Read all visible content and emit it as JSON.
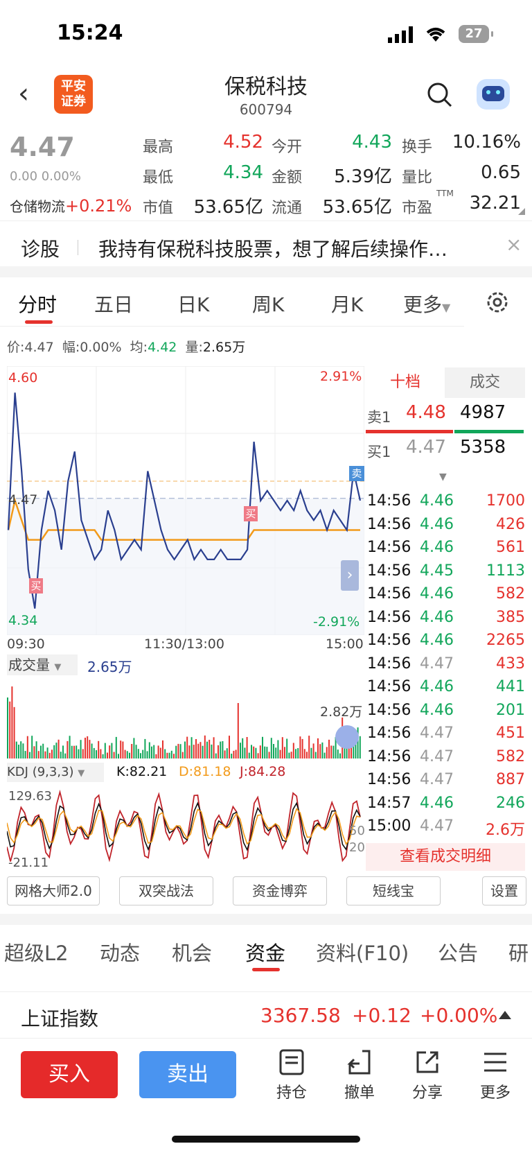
{
  "status": {
    "time": "15:24",
    "battery": "27"
  },
  "header": {
    "name": "保税科技",
    "code": "600794",
    "logo_text": "平安\n证券"
  },
  "quote": {
    "price": "4.47",
    "change": "0.00 0.00%",
    "sector_name": "仓储物流",
    "sector_change": "+0.21%",
    "high_label": "最高",
    "high": "4.52",
    "open_label": "今开",
    "open": "4.43",
    "turnover_label": "换手",
    "turnover": "10.16%",
    "low_label": "最低",
    "low": "4.34",
    "amount_label": "金额",
    "amount": "5.39亿",
    "ratio_label": "量比",
    "ratio": "0.65",
    "mcap_label": "市值",
    "mcap": "53.65亿",
    "float_label": "流通",
    "float": "53.65亿",
    "pe_label": "市盈",
    "pe_sup": "TTM",
    "pe": "32.21"
  },
  "diagnose": {
    "label": "诊股",
    "text": "我持有保税科技股票，想了解后续操作…"
  },
  "chart_tabs": [
    "分时",
    "五日",
    "日K",
    "周K",
    "月K",
    "更多"
  ],
  "info_line": {
    "price_label": "价:",
    "price": "4.47",
    "amp_label": "幅:",
    "amp": "0.00%",
    "avg_label": "均:",
    "avg": "4.42",
    "vol_label": "量:",
    "vol": "2.65万"
  },
  "chart": {
    "y_top": "4.60",
    "y_bottom": "4.34",
    "pct_top": "2.91%",
    "pct_bottom": "-2.91%",
    "mid": "4.47",
    "x_start": "09:30",
    "x_mid": "11:30/13:00",
    "x_end": "15:00",
    "buy_tag": "买",
    "sell_tag": "卖",
    "volume_label": "成交量",
    "volume_value": "2.65万",
    "volume_max": "2.82万",
    "kdj_label": "KDJ (9,3,3)",
    "k": "K:82.21",
    "d": "D:81.18",
    "j": "J:84.28",
    "kdj_top": "129.63",
    "kdj_bottom": "-21.11",
    "kdj_50": "50",
    "kdj_20": "20"
  },
  "chart_data": {
    "type": "line",
    "title": "",
    "ylim": [
      4.34,
      4.6
    ],
    "series": [
      {
        "values": [
          4.44,
          4.58,
          4.5,
          4.4,
          4.36,
          4.44,
          4.48,
          4.46,
          4.42,
          4.49,
          4.52,
          4.45,
          4.43,
          4.41,
          4.42,
          4.46,
          4.44,
          4.41,
          4.42,
          4.43,
          4.42,
          4.5,
          4.47,
          4.44,
          4.42,
          4.41,
          4.42,
          4.43,
          4.41,
          4.42,
          4.41,
          4.41,
          4.42,
          4.41,
          4.41,
          4.41,
          4.42,
          4.53,
          4.47,
          4.48,
          4.47,
          4.46,
          4.47,
          4.46,
          4.48,
          4.46,
          4.45,
          4.46,
          4.44,
          4.46,
          4.45,
          4.44,
          4.5,
          4.47
        ]
      },
      {
        "values": [
          4.44,
          4.47,
          4.45,
          4.43,
          4.43,
          4.43,
          4.44,
          4.44,
          4.44,
          4.44,
          4.44,
          4.44,
          4.44,
          4.44,
          4.43,
          4.43,
          4.43,
          4.43,
          4.43,
          4.43,
          4.43,
          4.43,
          4.43,
          4.43,
          4.43,
          4.43,
          4.43,
          4.43,
          4.43,
          4.43,
          4.43,
          4.43,
          4.43,
          4.43,
          4.43,
          4.43,
          4.43,
          4.44,
          4.44,
          4.44,
          4.44,
          4.44,
          4.44,
          4.44,
          4.44,
          4.44,
          4.44,
          4.44,
          4.44,
          4.44,
          4.44,
          4.44,
          4.44,
          4.44
        ]
      }
    ]
  },
  "order_book": {
    "tab_ten": "十档",
    "tab_trade": "成交",
    "sell1_label": "卖1",
    "sell1_price": "4.48",
    "sell1_vol": "4987",
    "buy1_label": "买1",
    "buy1_price": "4.47",
    "buy1_vol": "5358",
    "trades": [
      {
        "t": "14:56",
        "p": "4.46",
        "v": "1700",
        "pc": "green",
        "vc": "red"
      },
      {
        "t": "14:56",
        "p": "4.46",
        "v": "426",
        "pc": "green",
        "vc": "red"
      },
      {
        "t": "14:56",
        "p": "4.46",
        "v": "561",
        "pc": "green",
        "vc": "red"
      },
      {
        "t": "14:56",
        "p": "4.45",
        "v": "1113",
        "pc": "green",
        "vc": "green"
      },
      {
        "t": "14:56",
        "p": "4.46",
        "v": "582",
        "pc": "green",
        "vc": "red"
      },
      {
        "t": "14:56",
        "p": "4.46",
        "v": "385",
        "pc": "green",
        "vc": "red"
      },
      {
        "t": "14:56",
        "p": "4.46",
        "v": "2265",
        "pc": "green",
        "vc": "red"
      },
      {
        "t": "14:56",
        "p": "4.47",
        "v": "433",
        "pc": "gray",
        "vc": "red"
      },
      {
        "t": "14:56",
        "p": "4.46",
        "v": "441",
        "pc": "green",
        "vc": "green"
      },
      {
        "t": "14:56",
        "p": "4.46",
        "v": "201",
        "pc": "green",
        "vc": "green"
      },
      {
        "t": "14:56",
        "p": "4.47",
        "v": "451",
        "pc": "gray",
        "vc": "red"
      },
      {
        "t": "14:56",
        "p": "4.47",
        "v": "582",
        "pc": "gray",
        "vc": "red"
      },
      {
        "t": "14:56",
        "p": "4.47",
        "v": "887",
        "pc": "gray",
        "vc": "red"
      },
      {
        "t": "14:57",
        "p": "4.46",
        "v": "246",
        "pc": "green",
        "vc": "green"
      },
      {
        "t": "15:00",
        "p": "4.47",
        "v": "2.6万",
        "pc": "gray",
        "vc": "red"
      }
    ],
    "detail_link": "查看成交明细"
  },
  "tools": [
    "网格大师2.0",
    "双突战法",
    "资金博弈",
    "短线宝",
    "设置"
  ],
  "news_tabs": [
    "超级L2",
    "动态",
    "机会",
    "资金",
    "资料(F10)",
    "公告",
    "研"
  ],
  "index": {
    "name": "上证指数",
    "value": "3367.58",
    "change": "+0.12",
    "pct": "+0.00%"
  },
  "bottom": {
    "buy": "买入",
    "sell": "卖出",
    "position": "持仓",
    "cancel": "撤单",
    "share": "分享",
    "more": "更多"
  },
  "colors": {
    "up": "#e5322d",
    "down": "#11a65a",
    "avg_line": "#f29a1a",
    "price_line": "#2a3f8f"
  }
}
